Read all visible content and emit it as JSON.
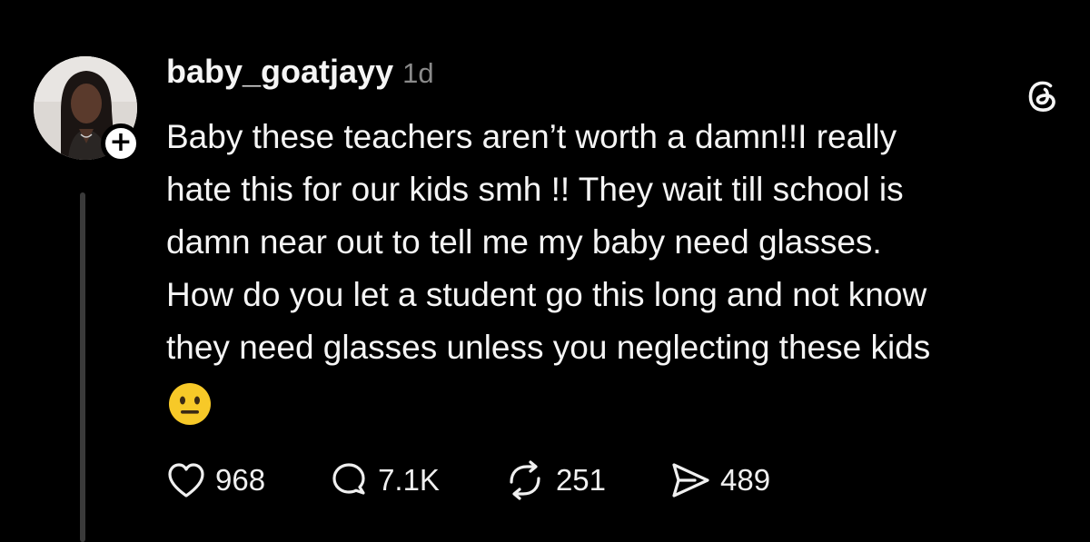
{
  "post": {
    "username": "baby_goatjayy",
    "timestamp": "1d",
    "follow_symbol": "+",
    "text_lines": [
      "Baby these teachers aren’t worth a damn!!I really",
      "hate this for our kids smh !! They wait till school is",
      "damn near out to tell me my baby need glasses.",
      "How do you let a student go this long and not know",
      "they need glasses unless you neglecting these kids"
    ],
    "emoji": "neutral-face-emoji",
    "actions": {
      "likes": "968",
      "replies": "7.1K",
      "reposts": "251",
      "shares": "489"
    }
  },
  "icons": {
    "app_logo": "threads-logo-icon",
    "like": "heart-icon",
    "reply": "speech-bubble-icon",
    "repost": "repost-arrows-icon",
    "share": "paper-plane-icon"
  },
  "colors": {
    "background": "#000000",
    "text": "#f5f5f5",
    "muted": "#8a8a8a",
    "thread_line": "#3a3a3a",
    "emoji_yellow": "#f7c928"
  }
}
